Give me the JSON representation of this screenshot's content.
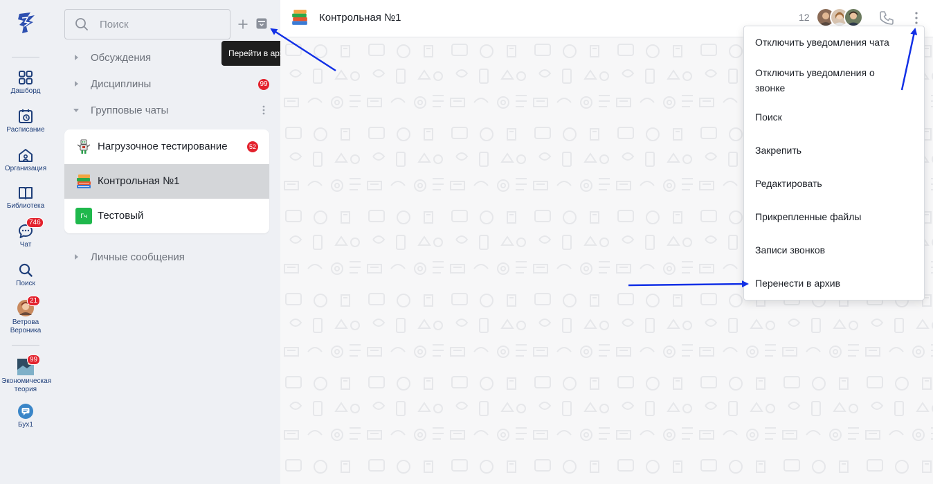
{
  "rail": {
    "items": [
      {
        "label": "Дашборд",
        "icon": "dashboard-icon"
      },
      {
        "label": "Расписание",
        "icon": "calendar-icon"
      },
      {
        "label": "Организация",
        "icon": "organization-icon"
      },
      {
        "label": "Библиотека",
        "icon": "library-icon"
      },
      {
        "label": "Чат",
        "icon": "chat-icon",
        "badge": "746"
      },
      {
        "label": "Поиск",
        "icon": "search-icon"
      },
      {
        "label": "Ветрова Вероника",
        "icon": "user-avatar",
        "badge": "21"
      },
      {
        "label": "Экономическая теория",
        "icon": "course-avatar",
        "badge": "99"
      },
      {
        "label": "Бух1",
        "icon": "course-chat-icon"
      }
    ]
  },
  "search": {
    "placeholder": "Поиск"
  },
  "tooltip": {
    "text": "Перейти в архив"
  },
  "sections": [
    {
      "title": "Обсуждения",
      "expanded": false
    },
    {
      "title": "Дисциплины",
      "expanded": false,
      "badge": "99"
    },
    {
      "title": "Групповые чаты",
      "expanded": true
    },
    {
      "title": "Личные сообщения",
      "expanded": false
    }
  ],
  "group_chats": [
    {
      "name": "Нагрузочное тестирование",
      "badge": "52"
    },
    {
      "name": "Контрольная №1",
      "active": true
    },
    {
      "name": "Тестовый",
      "avatar_text": "Гч"
    }
  ],
  "header": {
    "title": "Контрольная №1",
    "member_count": "12"
  },
  "menu": {
    "items": [
      "Отключить уведомления чата",
      "Отключить уведомления о звонке",
      "Поиск",
      "Закрепить",
      "Редактировать",
      "Прикрепленные файлы",
      "Записи звонков",
      "Перенести в архив"
    ]
  },
  "colors": {
    "accent_blue": "#1f3f7a",
    "badge_red": "#e3222d",
    "arrow_blue": "#1230e6"
  }
}
